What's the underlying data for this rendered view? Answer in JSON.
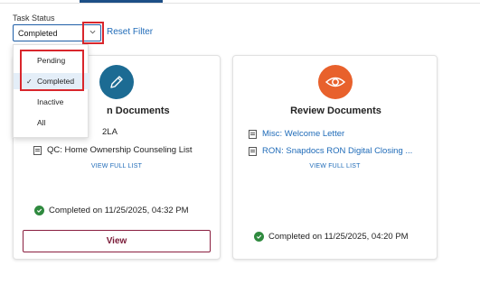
{
  "filter": {
    "label": "Task Status",
    "selected_value": "Completed",
    "reset_label": "Reset Filter",
    "options": [
      "Pending",
      "Completed",
      "Inactive",
      "All"
    ]
  },
  "cards": {
    "left": {
      "title": "n Documents",
      "item_fragment": "2LA",
      "item": "QC: Home Ownership Counseling List",
      "view_full_label": "VIEW FULL LIST",
      "status": "Completed on 11/25/2025, 04:32 PM",
      "button_label": "View"
    },
    "right": {
      "title": "Review Documents",
      "items": [
        "Misc: Welcome Letter",
        "RON: Snapdocs RON Digital Closing ..."
      ],
      "view_full_label": "VIEW FULL LIST",
      "status": "Completed on 11/25/2025, 04:20 PM"
    }
  },
  "colors": {
    "link": "#1f6bb8",
    "accent_blue": "#1c6b93",
    "accent_orange": "#e8612c",
    "success": "#2f8a3f",
    "button_border": "#8a1f3f",
    "highlight": "#d9262c"
  },
  "icons": {
    "left_card": "pencil-icon",
    "right_card": "eye-icon",
    "status": "check-circle-icon",
    "document": "document-icon",
    "dropdown": "chevron-down-icon"
  }
}
